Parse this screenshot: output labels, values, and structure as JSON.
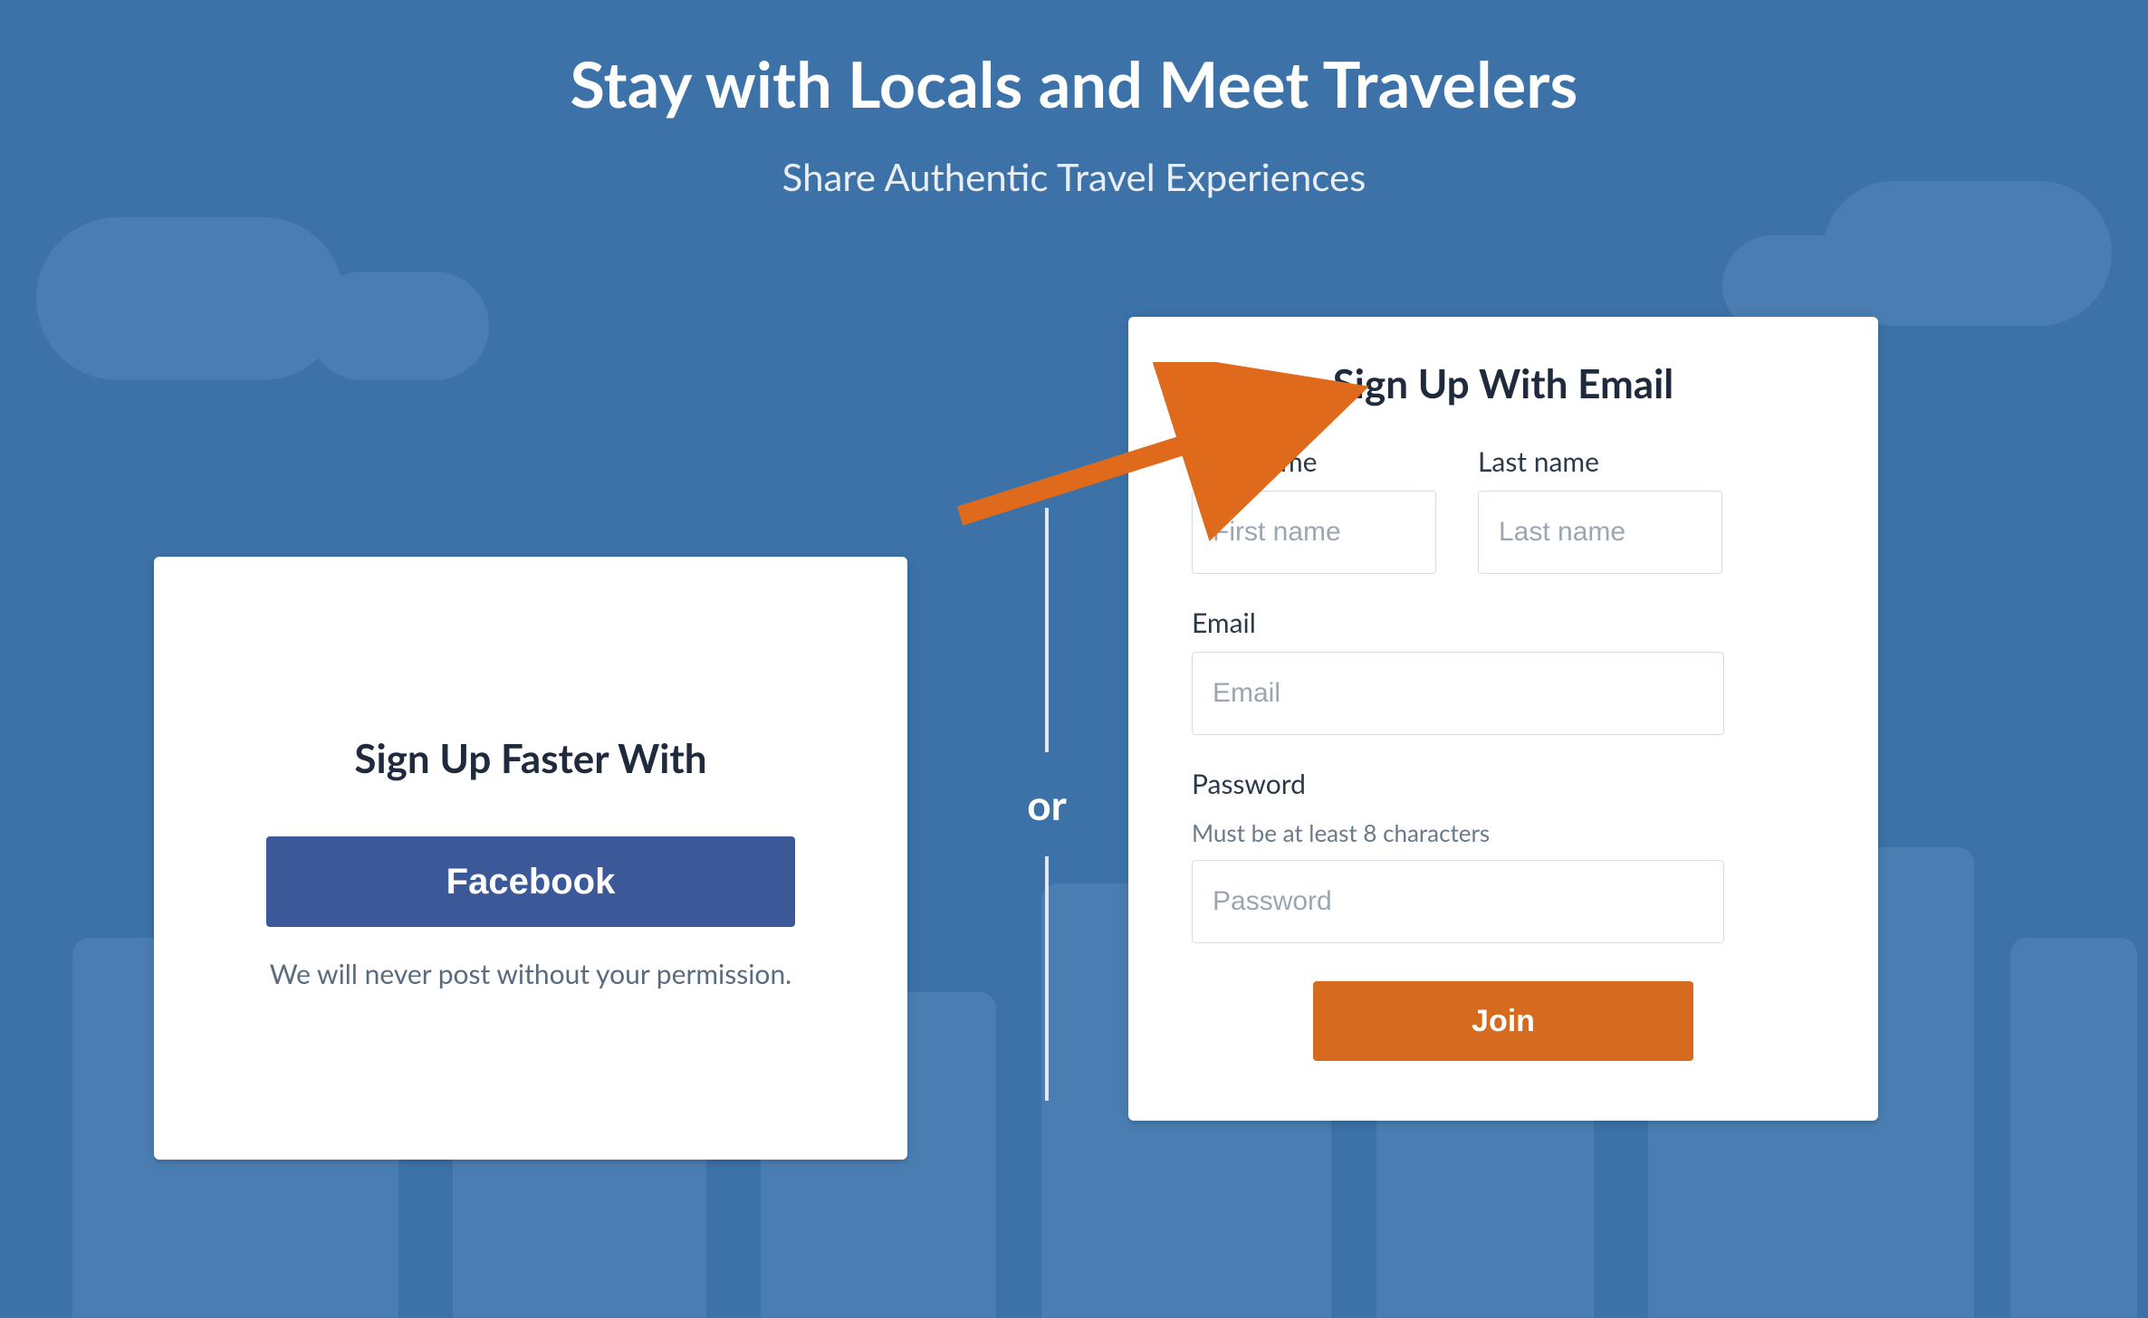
{
  "hero": {
    "title": "Stay with Locals and Meet Travelers",
    "subtitle": "Share Authentic Travel Experiences"
  },
  "divider": {
    "or": "or"
  },
  "fb_card": {
    "title": "Sign Up Faster With",
    "button": "Facebook",
    "note": "We will never post without your permission."
  },
  "email_card": {
    "title": "Sign Up With Email",
    "first_name_label": "First name",
    "first_name_placeholder": "First name",
    "last_name_label": "Last name",
    "last_name_placeholder": "Last name",
    "email_label": "Email",
    "email_placeholder": "Email",
    "password_label": "Password",
    "password_hint": "Must be at least 8 characters",
    "password_placeholder": "Password",
    "join_button": "Join"
  },
  "colors": {
    "bg": "#3c72a8",
    "bg_art": "#4a7eb2",
    "facebook": "#3b5998",
    "accent": "#d66b1f",
    "arrow": "#e06a1b"
  }
}
